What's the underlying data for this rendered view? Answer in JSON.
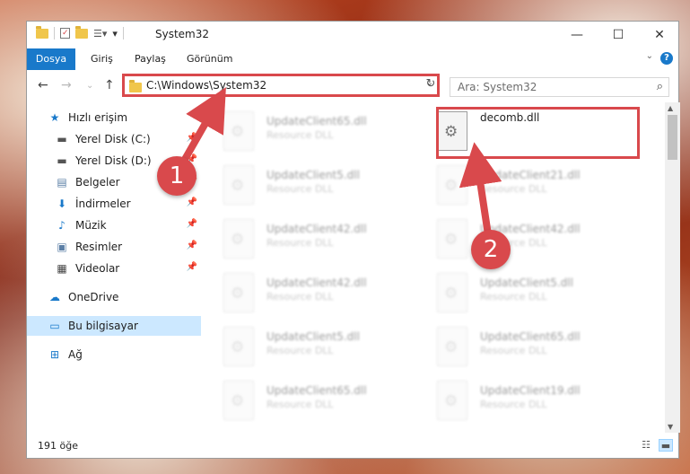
{
  "window": {
    "title": "System32",
    "controls": {
      "minimize": "—",
      "maximize": "☐",
      "close": "✕"
    }
  },
  "ribbon": {
    "tabs": [
      "Dosya",
      "Giriş",
      "Paylaş",
      "Görünüm"
    ],
    "help": "?"
  },
  "nav": {
    "address": "C:\\Windows\\System32",
    "search_placeholder": "Ara: System32"
  },
  "sidebar": {
    "items": [
      {
        "label": "Hızlı erişim",
        "icon": "star-icon"
      },
      {
        "label": "Yerel Disk (C:)",
        "icon": "drive-icon"
      },
      {
        "label": "Yerel Disk (D:)",
        "icon": "drive-icon"
      },
      {
        "label": "Belgeler",
        "icon": "document-icon"
      },
      {
        "label": "İndirmeler",
        "icon": "download-icon"
      },
      {
        "label": "Müzik",
        "icon": "music-icon"
      },
      {
        "label": "Resimler",
        "icon": "picture-icon"
      },
      {
        "label": "Videolar",
        "icon": "video-icon"
      },
      {
        "label": "OneDrive",
        "icon": "cloud-icon"
      },
      {
        "label": "Bu bilgisayar",
        "icon": "computer-icon"
      },
      {
        "label": "Ağ",
        "icon": "network-icon"
      }
    ]
  },
  "files": {
    "left_column": [
      {
        "name": "UpdateClient65.dll",
        "type": "Resource DLL"
      },
      {
        "name": "UpdateClient5.dll",
        "type": "Resource DLL"
      },
      {
        "name": "UpdateClient42.dll",
        "type": "Resource DLL"
      },
      {
        "name": "UpdateClient42.dll",
        "type": "Resource DLL"
      },
      {
        "name": "UpdateClient5.dll",
        "type": "Resource DLL"
      },
      {
        "name": "UpdateClient65.dll",
        "type": "Resource DLL"
      }
    ],
    "right_column": [
      {
        "name": "decomb.dll",
        "type": ""
      },
      {
        "name": "UpdateClient21.dll",
        "type": "Resource DLL"
      },
      {
        "name": "UpdateClient42.dll",
        "type": "Resource DLL"
      },
      {
        "name": "UpdateClient5.dll",
        "type": "Resource DLL"
      },
      {
        "name": "UpdateClient65.dll",
        "type": "Resource DLL"
      },
      {
        "name": "UpdateClient19.dll",
        "type": "Resource DLL"
      }
    ]
  },
  "status": {
    "item_count": "191 öğe"
  },
  "callouts": [
    "1",
    "2"
  ],
  "colors": {
    "accent": "#1979ca",
    "highlight": "#d9494c",
    "selection": "#cce8ff"
  }
}
